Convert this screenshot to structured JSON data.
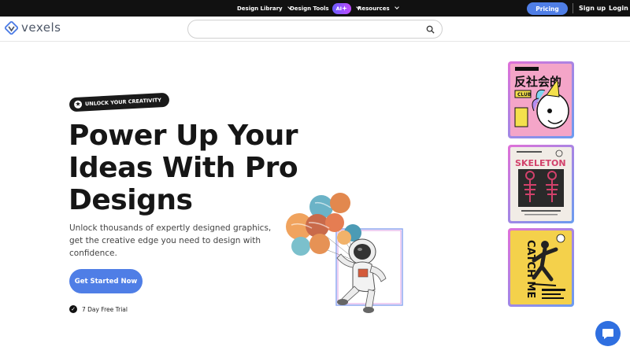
{
  "nav": {
    "items": [
      {
        "label": "Design Library"
      },
      {
        "label": "Design Tools",
        "badge": "AI"
      },
      {
        "label": "Resources"
      }
    ],
    "pricing": "Pricing",
    "signup": "Sign up",
    "login": "Login"
  },
  "header": {
    "logo_text": "vexels",
    "search_placeholder": ""
  },
  "hero": {
    "tag": "UNLOCK YOUR CREATIVITY",
    "headline_lines": [
      "Power Up Your",
      "Ideas With Pro",
      "Designs"
    ],
    "subtext": "Unlock thousands of expertly designed graphics, get the creative edge you need to design with confidence.",
    "cta": "Get Started Now",
    "trial": "7 Day Free Trial"
  },
  "cards": {
    "card1_title": "反社会的",
    "card1_caption": "CLUB",
    "card2_title": "SKELETON",
    "card3_title": "CATCH ME"
  },
  "colors": {
    "accent": "#4f7ee6",
    "nav_bg": "#111111",
    "card1_bg": "#f4a5c8",
    "card2_bg": "#f1ece6",
    "card3_bg": "#f4d14b"
  }
}
